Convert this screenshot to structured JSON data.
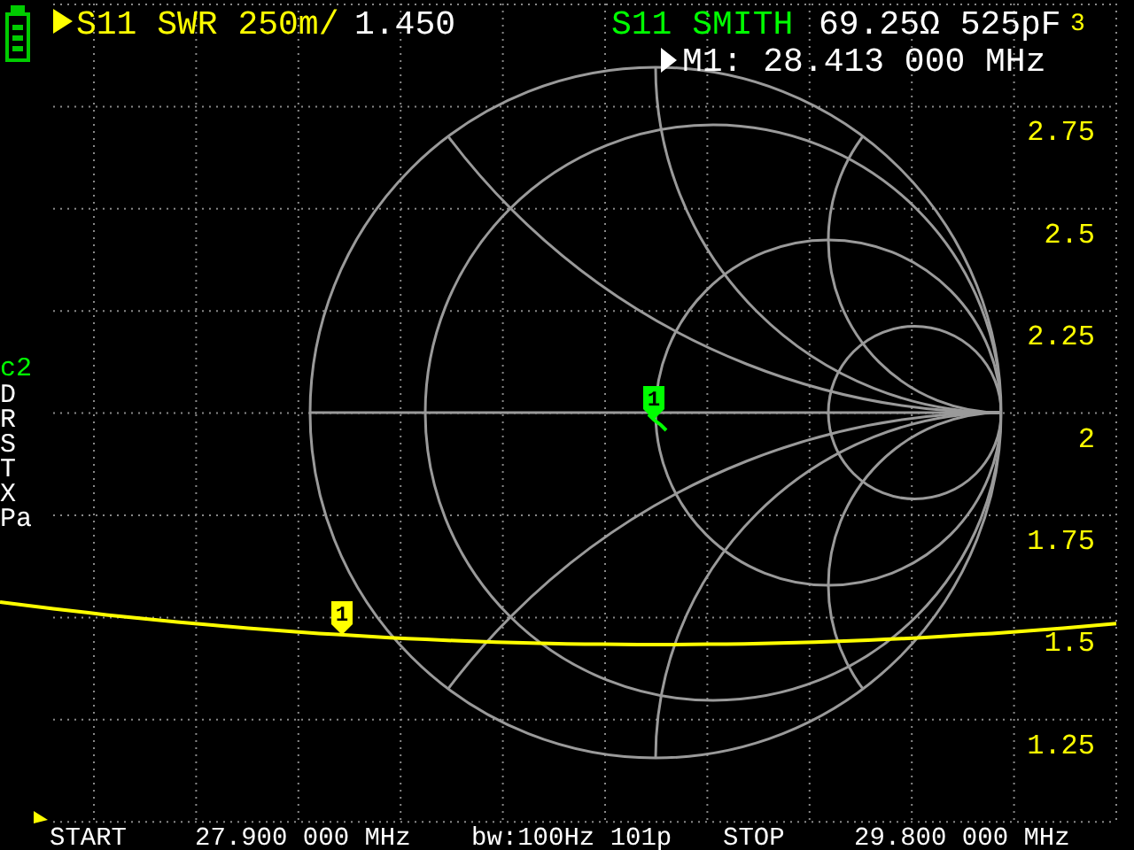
{
  "traces": [
    {
      "label": "S11 SWR 250m/",
      "value": "1.450",
      "color": "#ffff00",
      "selected": true,
      "kind": "swr",
      "marker": "1"
    },
    {
      "label": "S11 SMITH",
      "value": "69.25Ω 525pF",
      "color": "#00ff00",
      "selected": false,
      "kind": "smith",
      "marker": "1"
    }
  ],
  "indicator": "3",
  "marker_readout": {
    "text": "M1: 28.413 000 MHz",
    "selected": true
  },
  "scale_labels": [
    "2.75",
    "2.5",
    "2.25",
    "2",
    "1.75",
    "1.5",
    "1.25"
  ],
  "side_panel": {
    "title": "c2",
    "items": [
      "D",
      "R",
      "S",
      "T",
      "X",
      "Pa"
    ]
  },
  "footer": {
    "start_label": "START",
    "start": "27.900 000 MHz",
    "bandwidth": "bw:100Hz 101p",
    "stop_label": "STOP",
    "stop": "29.800 000 MHz"
  }
}
